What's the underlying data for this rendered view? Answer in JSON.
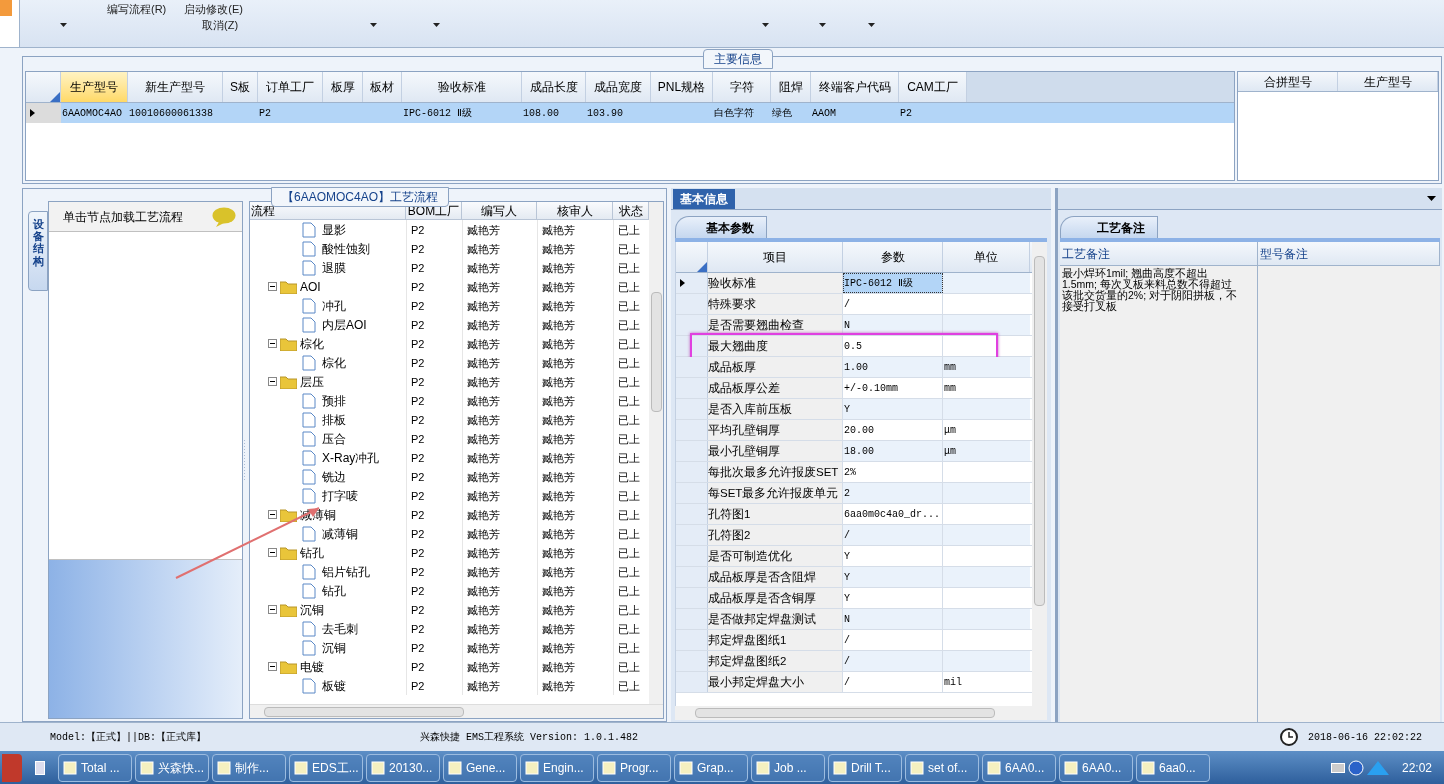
{
  "ribbon": {
    "row1": [
      "编写流程(R)",
      "启动修改(E)"
    ],
    "row2": [
      "取消(Z)"
    ]
  },
  "main_info": {
    "title": "主要信息",
    "columns": [
      {
        "label": "生产型号",
        "selected": true
      },
      {
        "label": "新生产型号",
        "selected": false
      },
      {
        "label": "S板",
        "selected": false
      },
      {
        "label": "订单工厂",
        "selected": false
      },
      {
        "label": "板厚",
        "selected": false
      },
      {
        "label": "板材",
        "selected": false
      },
      {
        "label": "验收标准",
        "selected": false
      },
      {
        "label": "成品长度",
        "selected": false
      },
      {
        "label": "成品宽度",
        "selected": false
      },
      {
        "label": "PNL规格",
        "selected": false
      },
      {
        "label": "字符",
        "selected": false
      },
      {
        "label": "阻焊",
        "selected": false
      },
      {
        "label": "终端客户代码",
        "selected": false
      },
      {
        "label": "CAM工厂",
        "selected": false
      }
    ],
    "rows": [
      {
        "selected": true,
        "cells": [
          {
            "text": "6AAOMOC4AO"
          },
          {
            "text": "10010600061338"
          },
          {},
          {
            "text": "P2"
          },
          {},
          {},
          {
            "text": "IPC-6012 Ⅱ级"
          },
          {
            "text": "108.00"
          },
          {
            "text": "103.90"
          },
          {},
          {
            "text": "白色字符"
          },
          {
            "text": "绿色"
          },
          {
            "text": "AAOM"
          },
          {
            "text": "P2"
          }
        ]
      }
    ],
    "side_columns": [
      "合拼型号",
      "生产型号"
    ]
  },
  "flow": {
    "title": "【6AAOMOC4AO】工艺流程",
    "side_tab": "设备结构",
    "panel_title": "单击节点加载工艺流程",
    "columns": [
      "流程",
      "BOM工厂",
      "编写人",
      "核审人",
      "状态"
    ],
    "nodes": [
      {
        "kind": "file",
        "label": "显影",
        "bom": "P2",
        "author": "臧艳芳",
        "reviewer": "臧艳芳",
        "status": "已上"
      },
      {
        "kind": "file",
        "label": "酸性蚀刻",
        "bom": "P2",
        "author": "臧艳芳",
        "reviewer": "臧艳芳",
        "status": "已上"
      },
      {
        "kind": "file",
        "label": "退膜",
        "bom": "P2",
        "author": "臧艳芳",
        "reviewer": "臧艳芳",
        "status": "已上"
      },
      {
        "kind": "folder",
        "label": "AOI",
        "bom": "P2",
        "author": "臧艳芳",
        "reviewer": "臧艳芳",
        "status": "已上",
        "expanded": true,
        "children": [
          {
            "kind": "file",
            "label": "冲孔",
            "bom": "P2",
            "author": "臧艳芳",
            "reviewer": "臧艳芳",
            "status": "已上"
          },
          {
            "kind": "file",
            "label": "内层AOI",
            "bom": "P2",
            "author": "臧艳芳",
            "reviewer": "臧艳芳",
            "status": "已上"
          }
        ]
      },
      {
        "kind": "folder",
        "label": "棕化",
        "bom": "P2",
        "author": "臧艳芳",
        "reviewer": "臧艳芳",
        "status": "已上",
        "expanded": true,
        "children": [
          {
            "kind": "file",
            "label": "棕化",
            "bom": "P2",
            "author": "臧艳芳",
            "reviewer": "臧艳芳",
            "status": "已上"
          }
        ]
      },
      {
        "kind": "folder",
        "label": "层压",
        "bom": "P2",
        "author": "臧艳芳",
        "reviewer": "臧艳芳",
        "status": "已上",
        "expanded": true,
        "children": [
          {
            "kind": "file",
            "label": "预排",
            "bom": "P2",
            "author": "臧艳芳",
            "reviewer": "臧艳芳",
            "status": "已上"
          },
          {
            "kind": "file",
            "label": "排板",
            "bom": "P2",
            "author": "臧艳芳",
            "reviewer": "臧艳芳",
            "status": "已上"
          },
          {
            "kind": "file",
            "label": "压合",
            "bom": "P2",
            "author": "臧艳芳",
            "reviewer": "臧艳芳",
            "status": "已上"
          },
          {
            "kind": "file",
            "label": "X-Ray冲孔",
            "bom": "P2",
            "author": "臧艳芳",
            "reviewer": "臧艳芳",
            "status": "已上"
          },
          {
            "kind": "file",
            "label": "铣边",
            "bom": "P2",
            "author": "臧艳芳",
            "reviewer": "臧艳芳",
            "status": "已上"
          },
          {
            "kind": "file",
            "label": "打字唛",
            "bom": "P2",
            "author": "臧艳芳",
            "reviewer": "臧艳芳",
            "status": "已上"
          }
        ]
      },
      {
        "kind": "folder",
        "label": "减薄铜",
        "bom": "P2",
        "author": "臧艳芳",
        "reviewer": "臧艳芳",
        "status": "已上",
        "expanded": true,
        "children": [
          {
            "kind": "file",
            "label": "减薄铜",
            "bom": "P2",
            "author": "臧艳芳",
            "reviewer": "臧艳芳",
            "status": "已上"
          }
        ]
      },
      {
        "kind": "folder",
        "label": "钻孔",
        "bom": "P2",
        "author": "臧艳芳",
        "reviewer": "臧艳芳",
        "status": "已上",
        "expanded": true,
        "children": [
          {
            "kind": "file",
            "label": "铝片钻孔",
            "bom": "P2",
            "author": "臧艳芳",
            "reviewer": "臧艳芳",
            "status": "已上"
          },
          {
            "kind": "file",
            "label": "钻孔",
            "bom": "P2",
            "author": "臧艳芳",
            "reviewer": "臧艳芳",
            "status": "已上"
          }
        ]
      },
      {
        "kind": "folder",
        "label": "沉铜",
        "bom": "P2",
        "author": "臧艳芳",
        "reviewer": "臧艳芳",
        "status": "已上",
        "expanded": true,
        "children": [
          {
            "kind": "file",
            "label": "去毛刺",
            "bom": "P2",
            "author": "臧艳芳",
            "reviewer": "臧艳芳",
            "status": "已上"
          },
          {
            "kind": "file",
            "label": "沉铜",
            "bom": "P2",
            "author": "臧艳芳",
            "reviewer": "臧艳芳",
            "status": "已上"
          }
        ]
      },
      {
        "kind": "folder",
        "label": "电镀",
        "bom": "P2",
        "author": "臧艳芳",
        "reviewer": "臧艳芳",
        "status": "已上",
        "expanded": true,
        "children": [
          {
            "kind": "file",
            "label": "板镀",
            "bom": "P2",
            "author": "臧艳芳",
            "reviewer": "臧艳芳",
            "status": "已上"
          }
        ]
      }
    ]
  },
  "basic": {
    "header": "基本信息",
    "tab": "基本参数",
    "columns": [
      "项目",
      "参数",
      "单位"
    ],
    "rows": [
      {
        "item": "验收标准",
        "value": "IPC-6012 Ⅱ级",
        "selected": true,
        "marked": false
      },
      {
        "item": "特殊要求",
        "value": "/",
        "selected": false,
        "marked": false
      },
      {
        "item": "是否需要翘曲检查",
        "value": "N",
        "selected": false,
        "marked": false
      },
      {
        "item": "最大翘曲度",
        "value": "0.5",
        "selected": false,
        "marked": true
      },
      {
        "item": "成品板厚",
        "value": "1.00",
        "unit": "mm",
        "selected": false,
        "marked": false
      },
      {
        "item": "成品板厚公差",
        "value": "+/-0.10mm",
        "unit": "mm",
        "selected": false,
        "marked": false
      },
      {
        "item": "是否入库前压板",
        "value": "Y",
        "selected": false,
        "marked": false
      },
      {
        "item": "平均孔壁铜厚",
        "value": "20.00",
        "unit": "μm",
        "selected": false,
        "marked": false
      },
      {
        "item": "最小孔壁铜厚",
        "value": "18.00",
        "unit": "μm",
        "selected": false,
        "marked": false
      },
      {
        "item": "每批次最多允许报废SET",
        "value": "2%",
        "selected": false,
        "marked": false
      },
      {
        "item": "每SET最多允许报废单元",
        "value": "2",
        "selected": false,
        "marked": false
      },
      {
        "item": "孔符图1",
        "value": "6aa0m0c4a0_dr...",
        "selected": false,
        "marked": false
      },
      {
        "item": "孔符图2",
        "value": "/",
        "selected": false,
        "marked": false
      },
      {
        "item": "是否可制造优化",
        "value": "Y",
        "selected": false,
        "marked": false
      },
      {
        "item": "成品板厚是否含阻焊",
        "value": "Y",
        "selected": false,
        "marked": false
      },
      {
        "item": "成品板厚是否含铜厚",
        "value": "Y",
        "selected": false,
        "marked": false
      },
      {
        "item": "是否做邦定焊盘测试",
        "value": "N",
        "selected": false,
        "marked": false
      },
      {
        "item": "邦定焊盘图纸1",
        "value": "/",
        "selected": false,
        "marked": false
      },
      {
        "item": "邦定焊盘图纸2",
        "value": "/",
        "selected": false,
        "marked": false
      },
      {
        "item": "最小邦定焊盘大小",
        "value": "/",
        "unit": "mil",
        "selected": false,
        "marked": false
      }
    ]
  },
  "notes": {
    "tab": "工艺备注",
    "columns": [
      "工艺备注",
      "型号备注"
    ],
    "process_note": "最小焊环1mil; 翘曲高度不超出1.5mm; 每次叉板来料总数不得超过该批交货量的2%; 对于阴阳拼板，不接受打叉板"
  },
  "status_bar": {
    "left": "Model:【正式】||DB:【正式库】",
    "center": "兴森快捷 EMS工程系统 Version: 1.0.1.482",
    "right": "2018-06-16 22:02:22"
  },
  "taskbar": {
    "items": [
      "Total ...",
      "兴森快...",
      "制作...",
      "EDS工...",
      "20130...",
      "Gene...",
      "Engin...",
      "Progr...",
      "Grap...",
      "Job ...",
      "Drill T...",
      "set of...",
      "6AA0...",
      "6AA0...",
      "6aa0..."
    ],
    "clock": "22:02"
  }
}
